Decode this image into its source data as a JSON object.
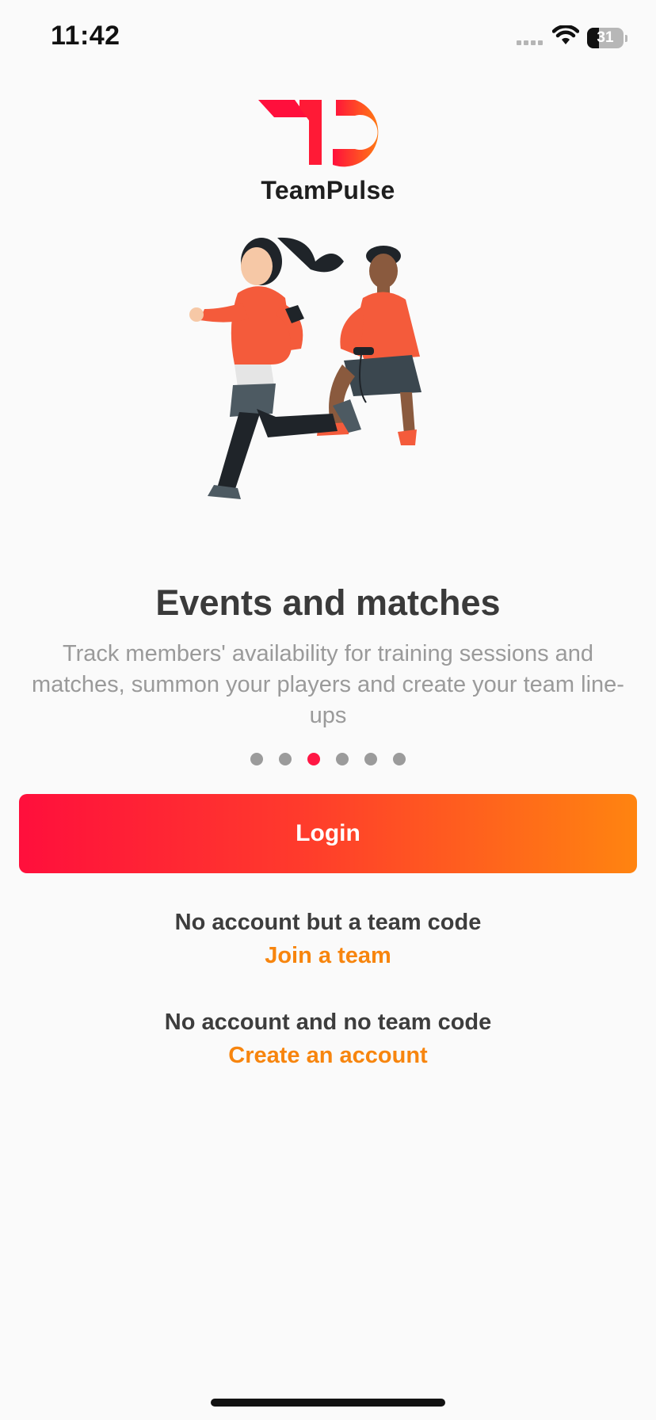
{
  "status_bar": {
    "time": "11:42",
    "battery": "31",
    "icons": [
      "cellular-signal-icon",
      "wifi-icon",
      "battery-icon"
    ]
  },
  "brand": {
    "name": "TeamPulse",
    "colors": {
      "gradient_start": "#ff0f3c",
      "gradient_end": "#ff8410"
    }
  },
  "onboarding": {
    "title": "Events and matches",
    "description": "Track members' availability for training sessions and matches, summon your players and create your team line-ups",
    "page_count": 6,
    "active_page": 3
  },
  "actions": {
    "login_label": "Login",
    "join_hint": "No account but a team code",
    "join_link": "Join a team",
    "create_hint": "No account and no team code",
    "create_link": "Create an account"
  },
  "colors": {
    "link": "#f7850e",
    "active_dot": "#ff1744",
    "inactive_dot": "#9b9b9b",
    "title": "#3a3a3a",
    "body": "#9a9a9a",
    "background": "#fafafa"
  }
}
